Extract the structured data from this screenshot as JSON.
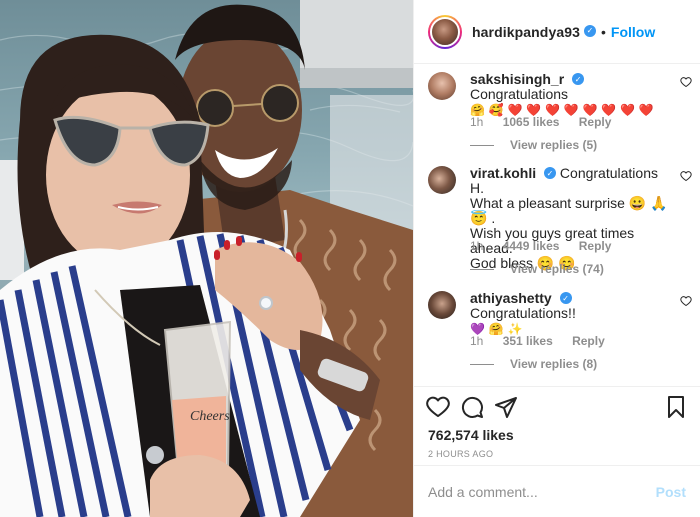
{
  "post": {
    "username": "hardikpandya93",
    "follow_label": "Follow",
    "dot": "•",
    "likes": "762,574 likes",
    "time": "2 HOURS AGO",
    "add_comment_placeholder": "Add a comment...",
    "post_label": "Post"
  },
  "comments": [
    {
      "username": "sakshisingh_r",
      "text": "Congratulations",
      "emoji": "🤗 🥰 ❤️ ❤️ ❤️ ❤️ ❤️ ❤️ ❤️ ❤️",
      "age": "1h",
      "likes": "1065 likes",
      "reply": "Reply",
      "view_replies": "View replies (5)"
    },
    {
      "username": "virat.kohli",
      "text_line1": "Congratulations H.",
      "text_line2": "What a pleasant surprise 😀 🙏 😇 .",
      "text_line3": "Wish you guys great times ahead.",
      "text_line4": "God bless 😊 😊",
      "age": "1h",
      "likes": "4449 likes",
      "reply": "Reply",
      "view_replies": "View replies (74)"
    },
    {
      "username": "athiyashetty",
      "text": "Congratulations!!",
      "emoji": "💜 🤗 ✨",
      "age": "1h",
      "likes": "351 likes",
      "reply": "Reply",
      "view_replies": "View replies (8)"
    }
  ],
  "icons": {
    "heart": "heart-icon",
    "comment": "comment-icon",
    "share": "share-icon",
    "save": "bookmark-icon",
    "verified": "verified-badge-icon"
  },
  "photo_text": "Cheers",
  "colors": {
    "follow": "#0095f6",
    "verified": "#3897f0",
    "muted": "#8e8e8e",
    "post_disabled": "#b2dffc"
  }
}
